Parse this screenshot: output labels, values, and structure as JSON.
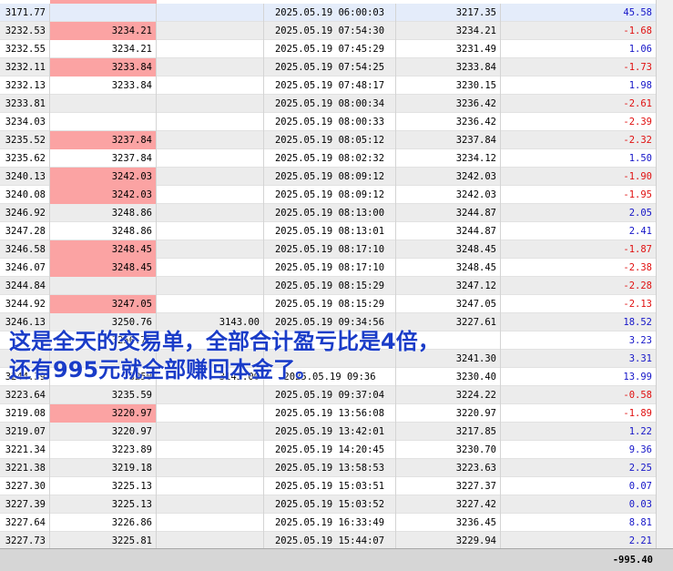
{
  "rows": [
    {
      "open": "3171.77",
      "sl": "",
      "tp": "",
      "time": "2025.05.19 06:00:03",
      "close": "3217.35",
      "profit": "45.58",
      "sl_hit": false,
      "selected": true
    },
    {
      "open": "3232.53",
      "sl": "3234.21",
      "tp": "",
      "time": "2025.05.19 07:54:30",
      "close": "3234.21",
      "profit": "-1.68",
      "sl_hit": true
    },
    {
      "open": "3232.55",
      "sl": "3234.21",
      "tp": "",
      "time": "2025.05.19 07:45:29",
      "close": "3231.49",
      "profit": "1.06",
      "sl_hit": false
    },
    {
      "open": "3232.11",
      "sl": "3233.84",
      "tp": "",
      "time": "2025.05.19 07:54:25",
      "close": "3233.84",
      "profit": "-1.73",
      "sl_hit": true
    },
    {
      "open": "3232.13",
      "sl": "3233.84",
      "tp": "",
      "time": "2025.05.19 07:48:17",
      "close": "3230.15",
      "profit": "1.98",
      "sl_hit": false
    },
    {
      "open": "3233.81",
      "sl": "",
      "tp": "",
      "time": "2025.05.19 08:00:34",
      "close": "3236.42",
      "profit": "-2.61",
      "sl_hit": false
    },
    {
      "open": "3234.03",
      "sl": "",
      "tp": "",
      "time": "2025.05.19 08:00:33",
      "close": "3236.42",
      "profit": "-2.39",
      "sl_hit": false
    },
    {
      "open": "3235.52",
      "sl": "3237.84",
      "tp": "",
      "time": "2025.05.19 08:05:12",
      "close": "3237.84",
      "profit": "-2.32",
      "sl_hit": true
    },
    {
      "open": "3235.62",
      "sl": "3237.84",
      "tp": "",
      "time": "2025.05.19 08:02:32",
      "close": "3234.12",
      "profit": "1.50",
      "sl_hit": false
    },
    {
      "open": "3240.13",
      "sl": "3242.03",
      "tp": "",
      "time": "2025.05.19 08:09:12",
      "close": "3242.03",
      "profit": "-1.90",
      "sl_hit": true
    },
    {
      "open": "3240.08",
      "sl": "3242.03",
      "tp": "",
      "time": "2025.05.19 08:09:12",
      "close": "3242.03",
      "profit": "-1.95",
      "sl_hit": true
    },
    {
      "open": "3246.92",
      "sl": "3248.86",
      "tp": "",
      "time": "2025.05.19 08:13:00",
      "close": "3244.87",
      "profit": "2.05",
      "sl_hit": false
    },
    {
      "open": "3247.28",
      "sl": "3248.86",
      "tp": "",
      "time": "2025.05.19 08:13:01",
      "close": "3244.87",
      "profit": "2.41",
      "sl_hit": false
    },
    {
      "open": "3246.58",
      "sl": "3248.45",
      "tp": "",
      "time": "2025.05.19 08:17:10",
      "close": "3248.45",
      "profit": "-1.87",
      "sl_hit": true
    },
    {
      "open": "3246.07",
      "sl": "3248.45",
      "tp": "",
      "time": "2025.05.19 08:17:10",
      "close": "3248.45",
      "profit": "-2.38",
      "sl_hit": true
    },
    {
      "open": "3244.84",
      "sl": "",
      "tp": "",
      "time": "2025.05.19 08:15:29",
      "close": "3247.12",
      "profit": "-2.28",
      "sl_hit": false
    },
    {
      "open": "3244.92",
      "sl": "3247.05",
      "tp": "",
      "time": "2025.05.19 08:15:29",
      "close": "3247.05",
      "profit": "-2.13",
      "sl_hit": true
    },
    {
      "open": "3246.13",
      "sl": "3250.76",
      "tp": "3143.00",
      "time": "2025.05.19 09:34:56",
      "close": "3227.61",
      "profit": "18.52",
      "sl_hit": false
    },
    {
      "open": "",
      "sl": "3250.76",
      "tp": "",
      "time": "",
      "close": "",
      "profit": "3.23",
      "sl_hit": false
    },
    {
      "open": "",
      "sl": "",
      "tp": "",
      "time": "",
      "close": "3241.30",
      "profit": "3.31",
      "sl_hit": false
    },
    {
      "open": "3244.39",
      "sl": "3250",
      "tp": "3143.00",
      "time": "2025.05.19 09:36",
      "close": "3230.40",
      "profit": "13.99",
      "sl_hit": false
    },
    {
      "open": "3223.64",
      "sl": "3235.59",
      "tp": "",
      "time": "2025.05.19 09:37:04",
      "close": "3224.22",
      "profit": "-0.58",
      "sl_hit": false
    },
    {
      "open": "3219.08",
      "sl": "3220.97",
      "tp": "",
      "time": "2025.05.19 13:56:08",
      "close": "3220.97",
      "profit": "-1.89",
      "sl_hit": true
    },
    {
      "open": "3219.07",
      "sl": "3220.97",
      "tp": "",
      "time": "2025.05.19 13:42:01",
      "close": "3217.85",
      "profit": "1.22",
      "sl_hit": false
    },
    {
      "open": "3221.34",
      "sl": "3223.89",
      "tp": "",
      "time": "2025.05.19 14:20:45",
      "close": "3230.70",
      "profit": "9.36",
      "sl_hit": false
    },
    {
      "open": "3221.38",
      "sl": "3219.18",
      "tp": "",
      "time": "2025.05.19 13:58:53",
      "close": "3223.63",
      "profit": "2.25",
      "sl_hit": false
    },
    {
      "open": "3227.30",
      "sl": "3225.13",
      "tp": "",
      "time": "2025.05.19 15:03:51",
      "close": "3227.37",
      "profit": "0.07",
      "sl_hit": false
    },
    {
      "open": "3227.39",
      "sl": "3225.13",
      "tp": "",
      "time": "2025.05.19 15:03:52",
      "close": "3227.42",
      "profit": "0.03",
      "sl_hit": false
    },
    {
      "open": "3227.64",
      "sl": "3226.86",
      "tp": "",
      "time": "2025.05.19 16:33:49",
      "close": "3236.45",
      "profit": "8.81",
      "sl_hit": false
    },
    {
      "open": "3227.73",
      "sl": "3225.81",
      "tp": "",
      "time": "2025.05.19 15:44:07",
      "close": "3229.94",
      "profit": "2.21",
      "sl_hit": false
    }
  ],
  "total_profit": "-995.40",
  "overlay": {
    "line1": "这是全天的交易单，全部合计盈亏比是4倍，",
    "line2": "还有995元就全部赚回本金了。"
  },
  "colors": {
    "positive": "#1515c8",
    "negative": "#e01010",
    "sl_highlight": "#fba3a3",
    "overlay_text": "#1a3cc8"
  }
}
